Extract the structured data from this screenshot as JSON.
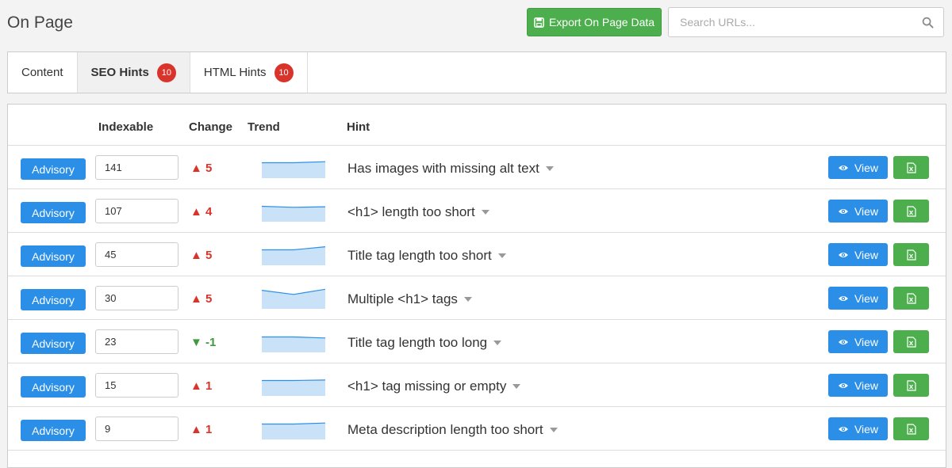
{
  "page": {
    "title": "On Page"
  },
  "toolbar": {
    "export_label": "Export On Page Data",
    "search_placeholder": "Search URLs..."
  },
  "tabs": [
    {
      "label": "Content",
      "badge": null,
      "active": false
    },
    {
      "label": "SEO Hints",
      "badge": "10",
      "active": true
    },
    {
      "label": "HTML Hints",
      "badge": "10",
      "active": false
    }
  ],
  "table": {
    "headers": {
      "indexable": "Indexable",
      "change": "Change",
      "trend": "Trend",
      "hint": "Hint"
    },
    "view_label": "View",
    "rows": [
      {
        "severity": "Advisory",
        "indexable": "141",
        "change": "5",
        "direction": "up",
        "hint": "Has images with missing alt text",
        "trend": [
          3,
          3,
          3.2
        ]
      },
      {
        "severity": "Advisory",
        "indexable": "107",
        "change": "4",
        "direction": "up",
        "hint": "<h1> length too short",
        "trend": [
          3,
          2.8,
          2.9
        ]
      },
      {
        "severity": "Advisory",
        "indexable": "45",
        "change": "5",
        "direction": "up",
        "hint": "Title tag length too short",
        "trend": [
          3,
          3,
          3.6
        ]
      },
      {
        "severity": "Advisory",
        "indexable": "30",
        "change": "5",
        "direction": "up",
        "hint": "Multiple <h1> tags",
        "trend": [
          3.6,
          2.8,
          3.8
        ]
      },
      {
        "severity": "Advisory",
        "indexable": "23",
        "change": "-1",
        "direction": "down",
        "hint": "Title tag length too long",
        "trend": [
          3,
          3,
          2.8
        ]
      },
      {
        "severity": "Advisory",
        "indexable": "15",
        "change": "1",
        "direction": "up",
        "hint": "<h1> tag missing or empty",
        "trend": [
          3,
          3,
          3.1
        ]
      },
      {
        "severity": "Advisory",
        "indexable": "9",
        "change": "1",
        "direction": "up",
        "hint": "Meta description length too short",
        "trend": [
          3,
          3,
          3.2
        ]
      }
    ]
  },
  "colors": {
    "primary": "#2b8fe8",
    "success": "#4cae4c",
    "danger": "#d9342b",
    "positive_change": "#3d9a3d",
    "trend_line": "#2b8fe8",
    "trend_fill": "#c9e2f7"
  }
}
